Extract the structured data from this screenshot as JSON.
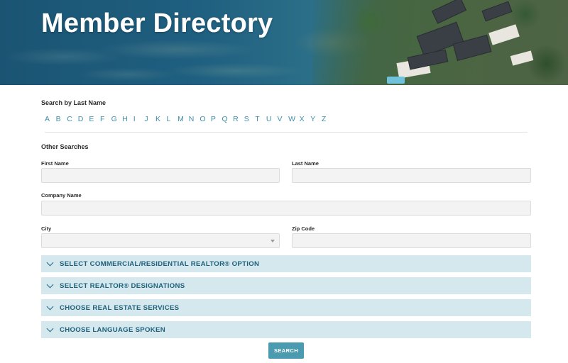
{
  "hero": {
    "title": "Member Directory"
  },
  "search_by_last_name": {
    "label": "Search by Last Name",
    "letters": [
      "A",
      "B",
      "C",
      "D",
      "E",
      "F",
      "G",
      "H",
      "I",
      "J",
      "K",
      "L",
      "M",
      "N",
      "O",
      "P",
      "Q",
      "R",
      "S",
      "T",
      "U",
      "V",
      "W",
      "X",
      "Y",
      "Z"
    ],
    "link_color": "#3f8fa8"
  },
  "other_searches": {
    "label": "Other Searches",
    "first_name": {
      "label": "First Name",
      "value": "",
      "placeholder": ""
    },
    "last_name": {
      "label": "Last Name",
      "value": "",
      "placeholder": ""
    },
    "company_name": {
      "label": "Company Name",
      "value": "",
      "placeholder": ""
    },
    "city": {
      "label": "City",
      "selected": ""
    },
    "zip_code": {
      "label": "Zip Code",
      "value": "",
      "placeholder": ""
    }
  },
  "accordions": [
    {
      "label": "SELECT COMMERCIAL/RESIDENTIAL REALTOR® OPTION",
      "icon": "chevron-down-icon"
    },
    {
      "label": "SELECT REALTOR® DESIGNATIONS",
      "icon": "chevron-down-icon"
    },
    {
      "label": "CHOOSE REAL ESTATE SERVICES",
      "icon": "chevron-down-icon"
    },
    {
      "label": "CHOOSE LANGUAGE SPOKEN",
      "icon": "chevron-down-icon"
    }
  ],
  "search_button": {
    "label": "SEARCH",
    "color": "#4a9bb0"
  },
  "colors": {
    "accordion_bg": "#d5e8ed",
    "accordion_text": "#1e5f7b",
    "field_bg": "#f3f3f3"
  }
}
